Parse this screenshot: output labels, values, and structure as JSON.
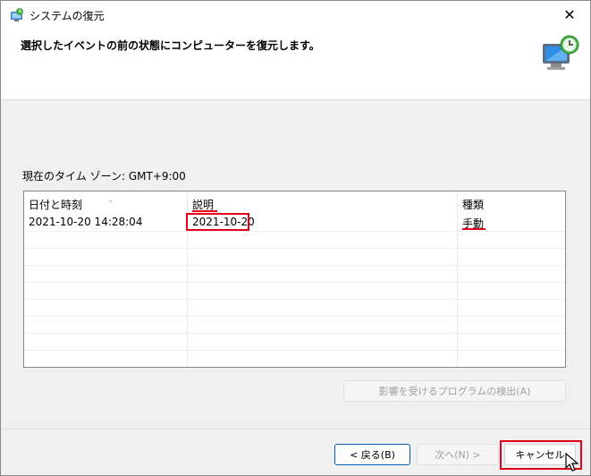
{
  "window": {
    "title": "システムの復元",
    "close_glyph": "✕"
  },
  "header": {
    "instruction": "選択したイベントの前の状態にコンピューターを復元します。"
  },
  "timezone": "現在のタイム ゾーン: GMT+9:00",
  "table": {
    "columns": [
      "日付と時刻",
      "説明",
      "種類"
    ],
    "rows": [
      {
        "datetime": "2021-10-20  14:28:04",
        "description": "2021-10-20",
        "type": "手動"
      }
    ]
  },
  "buttons": {
    "scan": "影響を受けるプログラムの検出(A)",
    "back": "< 戻る(B)",
    "next": "次へ(N) >",
    "cancel": "キャンセル"
  },
  "highlight_color": "#e2001a",
  "accent_color": "#005fb8"
}
